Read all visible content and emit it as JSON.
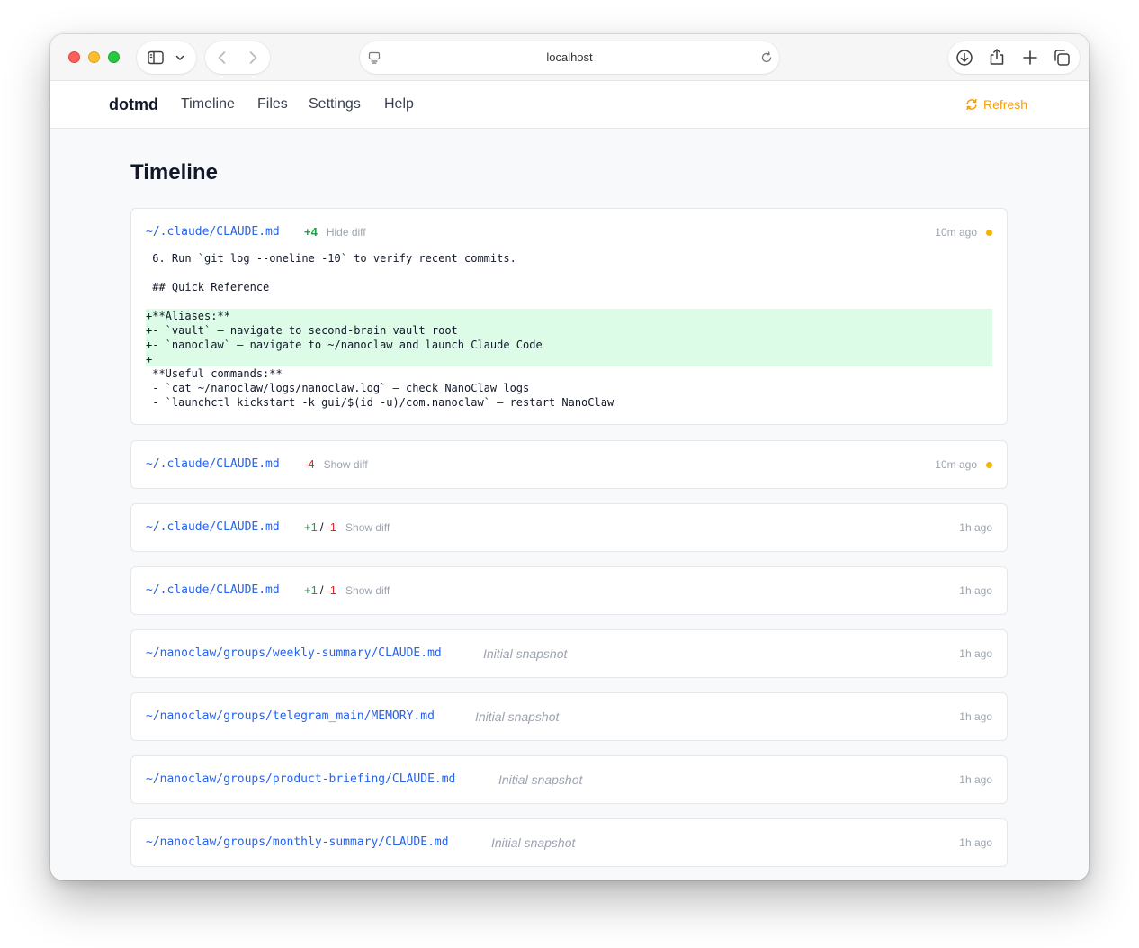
{
  "browser": {
    "url": "localhost"
  },
  "nav": {
    "brand": "dotmd",
    "links": [
      "Timeline",
      "Files",
      "Settings",
      "Help"
    ],
    "refresh_label": "Refresh"
  },
  "page": {
    "title": "Timeline"
  },
  "entries": [
    {
      "path": "~/.claude/CLAUDE.md",
      "added": "+4",
      "toggle": "Hide diff",
      "time": "10m ago",
      "unread": true,
      "diff_lines": [
        {
          "type": "context",
          "text": " 6. Run `git log --oneline -10` to verify recent commits."
        },
        {
          "type": "context",
          "text": " "
        },
        {
          "type": "context",
          "text": " ## Quick Reference"
        },
        {
          "type": "context",
          "text": " "
        },
        {
          "type": "added",
          "text": "+**Aliases:**"
        },
        {
          "type": "added",
          "text": "+- `vault` — navigate to second-brain vault root"
        },
        {
          "type": "added",
          "text": "+- `nanoclaw` — navigate to ~/nanoclaw and launch Claude Code"
        },
        {
          "type": "added",
          "text": "+"
        },
        {
          "type": "context",
          "text": " **Useful commands:**"
        },
        {
          "type": "context",
          "text": " - `cat ~/nanoclaw/logs/nanoclaw.log` — check NanoClaw logs"
        },
        {
          "type": "context",
          "text": " - `launchctl kickstart -k gui/$(id -u)/com.nanoclaw` — restart NanoClaw"
        }
      ]
    },
    {
      "path": "~/.claude/CLAUDE.md",
      "removed": "-4",
      "toggle": "Show diff",
      "time": "10m ago",
      "unread": true
    },
    {
      "path": "~/.claude/CLAUDE.md",
      "added": "+1",
      "separator": "/",
      "removed": "-1",
      "toggle": "Show diff",
      "time": "1h ago"
    },
    {
      "path": "~/.claude/CLAUDE.md",
      "added": "+1",
      "separator": "/",
      "removed": "-1",
      "toggle": "Show diff",
      "time": "1h ago"
    },
    {
      "path": "~/nanoclaw/groups/weekly-summary/CLAUDE.md",
      "snapshot": "Initial snapshot",
      "time": "1h ago"
    },
    {
      "path": "~/nanoclaw/groups/telegram_main/MEMORY.md",
      "snapshot": "Initial snapshot",
      "time": "1h ago"
    },
    {
      "path": "~/nanoclaw/groups/product-briefing/CLAUDE.md",
      "snapshot": "Initial snapshot",
      "time": "1h ago"
    },
    {
      "path": "~/nanoclaw/groups/monthly-summary/CLAUDE.md",
      "snapshot": "Initial snapshot",
      "time": "1h ago"
    }
  ],
  "colors": {
    "link": "#2563eb",
    "added": "#16a34a",
    "removed": "#dc2626",
    "accent": "#f59e0b",
    "added_bg": "#dcfce7"
  }
}
